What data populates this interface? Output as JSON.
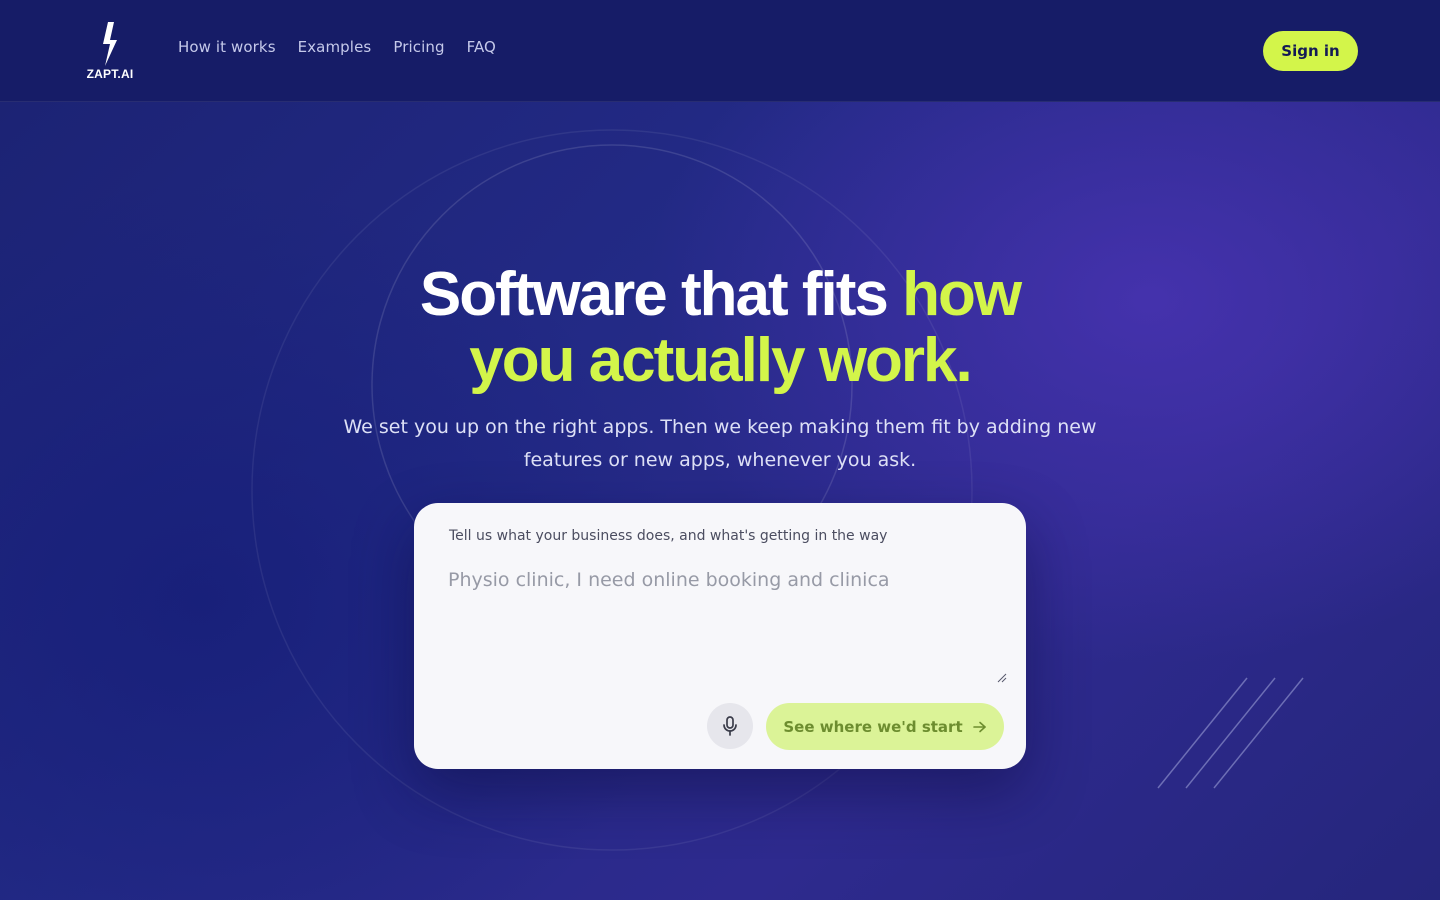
{
  "brand": {
    "name": "ZAPT.AI",
    "accent_color": "#d3f54a",
    "background_color": "#1d2371",
    "icon": "lightning-bolt-icon"
  },
  "nav": {
    "items": [
      {
        "label": "How it works"
      },
      {
        "label": "Examples"
      },
      {
        "label": "Pricing"
      },
      {
        "label": "FAQ"
      }
    ],
    "signin_label": "Sign in"
  },
  "hero": {
    "title_white": "Software that fits ",
    "title_accent_1": "how",
    "title_accent_2": "you actually work.",
    "subtitle": "We set you up on the right apps. Then we keep making them fit by adding new features or new apps, whenever you ask."
  },
  "prompt_card": {
    "label": "Tell us what your business does, and what's getting in the way",
    "placeholder": "Physio clinic, I need online booking and clinica",
    "mic_icon": "microphone-icon",
    "cta_label": "See where we'd start",
    "cta_icon": "arrow-right-icon"
  }
}
